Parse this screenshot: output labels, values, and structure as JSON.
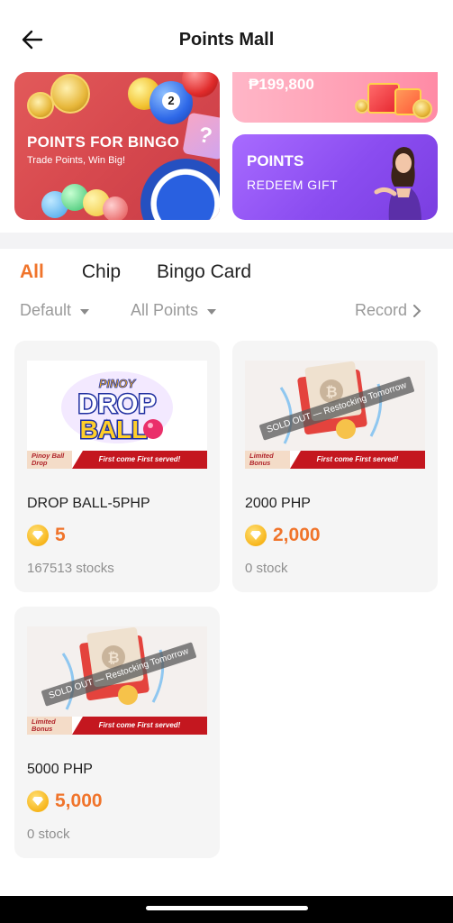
{
  "header": {
    "title": "Points Mall",
    "back_icon": "arrow-left-icon"
  },
  "banners": {
    "bingo": {
      "title": "POINTS FOR BINGO",
      "subtitle": "Trade Points, Win Big!",
      "ball_number": "2"
    },
    "jackpot": {
      "amount": "₱199,800"
    },
    "redeem": {
      "title": "POINTS",
      "subtitle": "REDEEM GIFT"
    }
  },
  "tabs": [
    {
      "label": "All",
      "active": true
    },
    {
      "label": "Chip",
      "active": false
    },
    {
      "label": "Bingo Card",
      "active": false
    }
  ],
  "filters": {
    "sort": "Default",
    "points": "All Points",
    "record": "Record"
  },
  "products": [
    {
      "name": "DROP BALL-5PHP",
      "price": "5",
      "stock": "167513 stocks",
      "image_text": {
        "brand_top": "PINOY",
        "brand_mid": "DROP",
        "brand_bottom": "BALL"
      },
      "ribbon_left": "Pinoy Ball Drop",
      "ribbon_right": "First come First served!",
      "sold_out": ""
    },
    {
      "name": "2000 PHP",
      "price": "2,000",
      "stock": "0 stock",
      "ribbon_left": "Limited Bonus",
      "ribbon_right": "First come First served!",
      "sold_out": "SOLD OUT — Restocking Tomorrow"
    },
    {
      "name": "5000 PHP",
      "price": "5,000",
      "stock": "0 stock",
      "ribbon_left": "Limited Bonus",
      "ribbon_right": "First come First served!",
      "sold_out": "SOLD OUT — Restocking Tomorrow"
    }
  ],
  "colors": {
    "accent": "#f0742b",
    "bingo_banner": "#d84a4f",
    "redeem_banner": "#8a4cf0",
    "jackpot_banner": "#ff9fb4"
  }
}
